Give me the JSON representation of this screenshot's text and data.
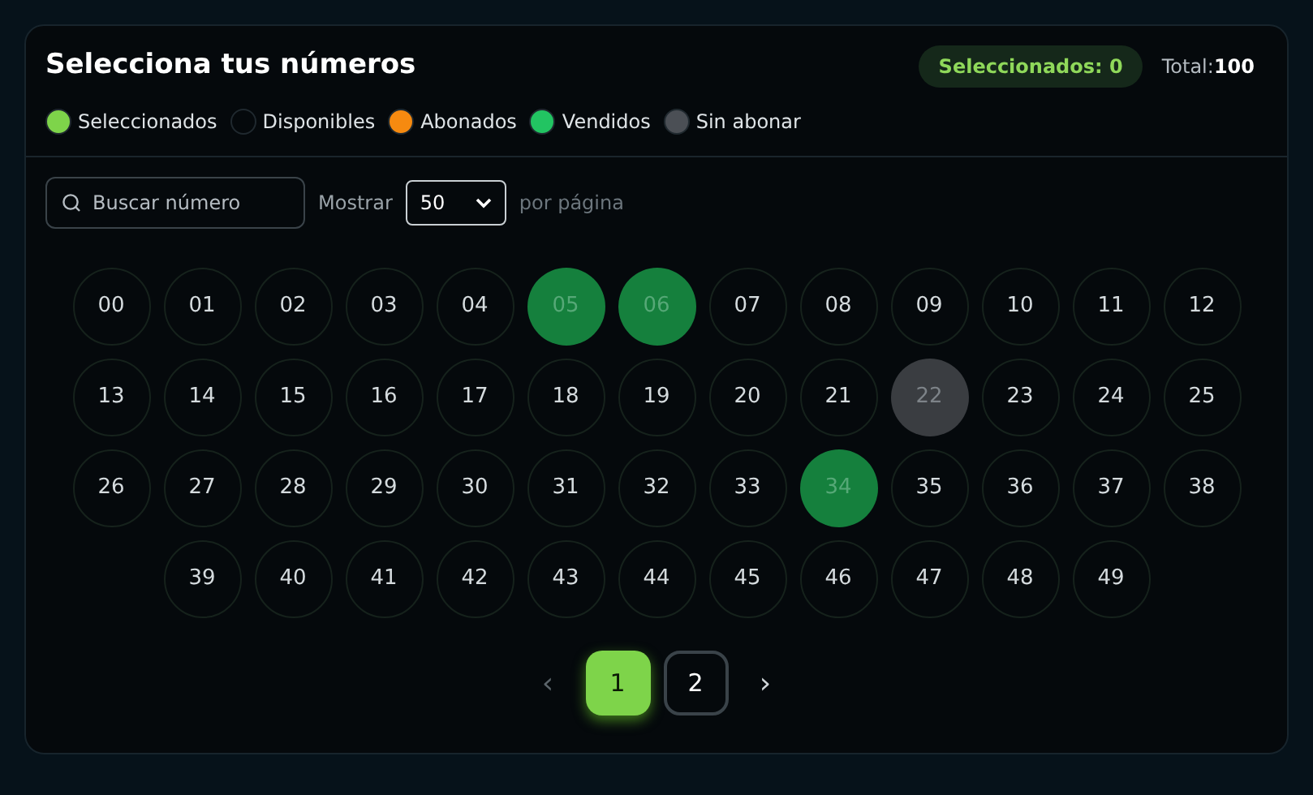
{
  "header": {
    "title": "Selecciona tus números",
    "selected_badge": "Seleccionados: 0",
    "total_label": "Total:",
    "total_value": "100"
  },
  "legend": [
    {
      "label": "Seleccionados",
      "color": "#7ed44a"
    },
    {
      "label": "Disponibles",
      "color": "#05090c"
    },
    {
      "label": "Abonados",
      "color": "#f68a10"
    },
    {
      "label": "Vendidos",
      "color": "#22c462"
    },
    {
      "label": "Sin abonar",
      "color": "#4b4f55"
    }
  ],
  "search": {
    "placeholder": "Buscar número"
  },
  "page_size": {
    "label": "Mostrar",
    "value": "50",
    "suffix": "por página"
  },
  "numbers": [
    {
      "label": "00",
      "kind": "available"
    },
    {
      "label": "01",
      "kind": "available"
    },
    {
      "label": "02",
      "kind": "available"
    },
    {
      "label": "03",
      "kind": "available"
    },
    {
      "label": "04",
      "kind": "available"
    },
    {
      "label": "05",
      "kind": "sold"
    },
    {
      "label": "06",
      "kind": "sold"
    },
    {
      "label": "07",
      "kind": "available"
    },
    {
      "label": "08",
      "kind": "available"
    },
    {
      "label": "09",
      "kind": "available"
    },
    {
      "label": "10",
      "kind": "available"
    },
    {
      "label": "11",
      "kind": "available"
    },
    {
      "label": "12",
      "kind": "available"
    },
    {
      "label": "13",
      "kind": "available"
    },
    {
      "label": "14",
      "kind": "available"
    },
    {
      "label": "15",
      "kind": "available"
    },
    {
      "label": "16",
      "kind": "available"
    },
    {
      "label": "17",
      "kind": "available"
    },
    {
      "label": "18",
      "kind": "available"
    },
    {
      "label": "19",
      "kind": "available"
    },
    {
      "label": "20",
      "kind": "available"
    },
    {
      "label": "21",
      "kind": "available"
    },
    {
      "label": "22",
      "kind": "unpaid"
    },
    {
      "label": "23",
      "kind": "available"
    },
    {
      "label": "24",
      "kind": "available"
    },
    {
      "label": "25",
      "kind": "available"
    },
    {
      "label": "26",
      "kind": "available"
    },
    {
      "label": "27",
      "kind": "available"
    },
    {
      "label": "28",
      "kind": "available"
    },
    {
      "label": "29",
      "kind": "available"
    },
    {
      "label": "30",
      "kind": "available"
    },
    {
      "label": "31",
      "kind": "available"
    },
    {
      "label": "32",
      "kind": "available"
    },
    {
      "label": "33",
      "kind": "available"
    },
    {
      "label": "34",
      "kind": "sold"
    },
    {
      "label": "35",
      "kind": "available"
    },
    {
      "label": "36",
      "kind": "available"
    },
    {
      "label": "37",
      "kind": "available"
    },
    {
      "label": "38",
      "kind": "available"
    },
    {
      "label": "39",
      "kind": "available"
    },
    {
      "label": "40",
      "kind": "available"
    },
    {
      "label": "41",
      "kind": "available"
    },
    {
      "label": "42",
      "kind": "available"
    },
    {
      "label": "43",
      "kind": "available"
    },
    {
      "label": "44",
      "kind": "available"
    },
    {
      "label": "45",
      "kind": "available"
    },
    {
      "label": "46",
      "kind": "available"
    },
    {
      "label": "47",
      "kind": "available"
    },
    {
      "label": "48",
      "kind": "available"
    },
    {
      "label": "49",
      "kind": "available"
    }
  ],
  "pagination": {
    "prev": "‹",
    "next": "›",
    "pages": [
      {
        "label": "1",
        "selected": true
      },
      {
        "label": "2",
        "selected": false
      }
    ]
  }
}
